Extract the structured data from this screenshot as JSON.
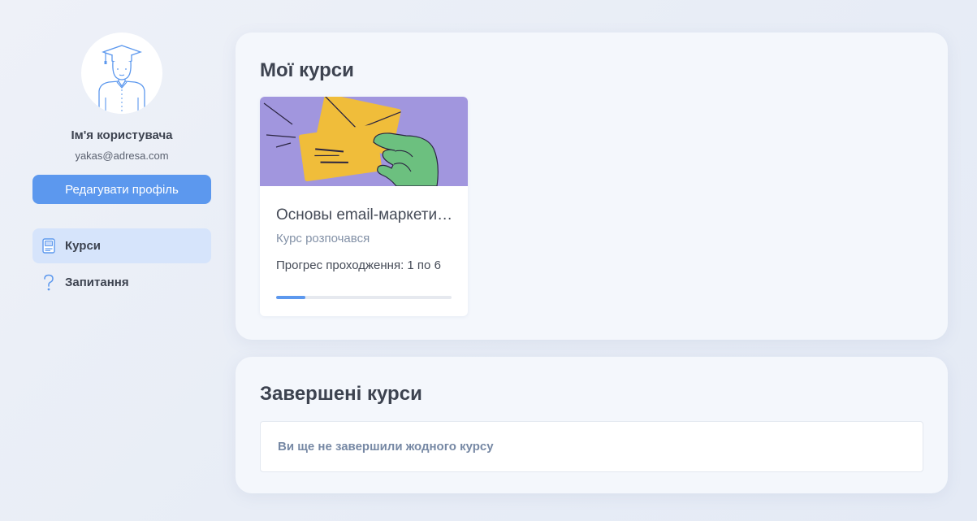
{
  "profile": {
    "name": "Ім'я користувача",
    "email": "yakas@adresa.com",
    "edit_button": "Редагувати профіль",
    "avatar_icon": "student-avatar-icon"
  },
  "nav": {
    "items": [
      {
        "label": "Курси",
        "icon": "book-icon",
        "active": true
      },
      {
        "label": "Запитання",
        "icon": "question-icon",
        "active": false
      }
    ]
  },
  "my_courses": {
    "title": "Мої курси",
    "courses": [
      {
        "title": "Основы email-маркетинга",
        "status": "Курс розпочався",
        "progress_text": "Прогрес проходження: 1 по 6",
        "progress_fraction": 0.1667
      }
    ]
  },
  "completed_courses": {
    "title": "Завершені курси",
    "empty_message": "Ви ще не завершили жодного курсу"
  },
  "colors": {
    "accent": "#5c98ee",
    "active_nav_bg": "#d6e4fb",
    "course_image_bg": "#a196de",
    "envelope": "#f0bd3a",
    "hand": "#6cc07f"
  }
}
